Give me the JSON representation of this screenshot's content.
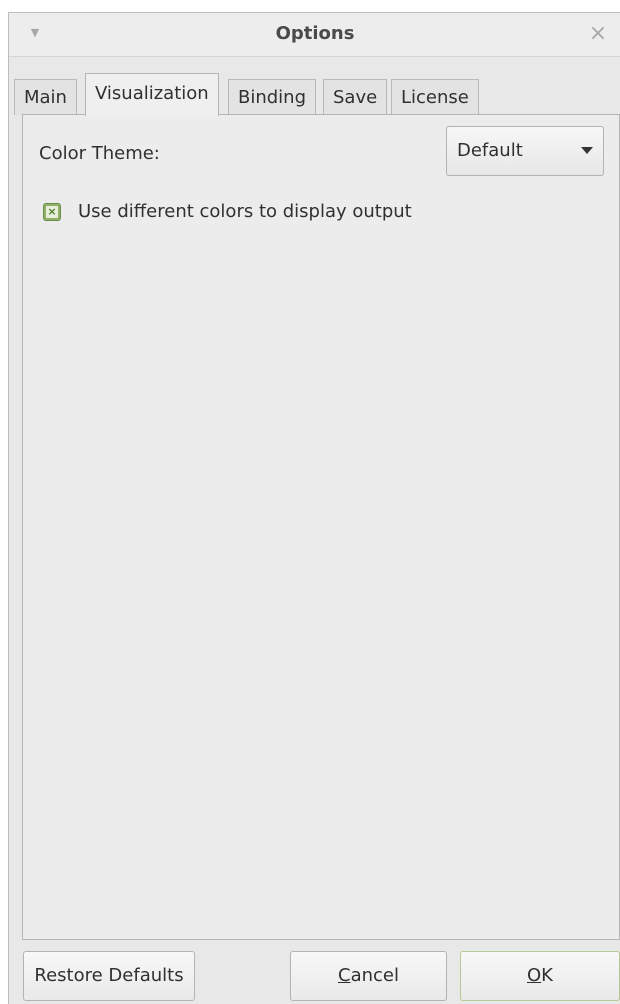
{
  "window": {
    "title": "Options",
    "menu_icon": "chevron-down-icon",
    "close_icon": "close-icon",
    "close_glyph": "×"
  },
  "tabs": [
    {
      "label": "Main",
      "active": false
    },
    {
      "label": "Visualization",
      "active": true
    },
    {
      "label": "Binding",
      "active": false
    },
    {
      "label": "Save",
      "active": false
    },
    {
      "label": "License",
      "active": false
    }
  ],
  "visualization": {
    "color_theme_label": "Color Theme:",
    "color_theme_value": "Default",
    "diff_colors_label": "Use different colors to display output",
    "diff_colors_checked": true
  },
  "buttons": {
    "restore_defaults": "Restore Defaults",
    "cancel_mnemonic": "C",
    "cancel_rest": "ancel",
    "ok_mnemonic": "O",
    "ok_rest": "K"
  },
  "colors": {
    "checkbox_accent": "#8fb069",
    "window_bg": "#e8e8e8"
  }
}
